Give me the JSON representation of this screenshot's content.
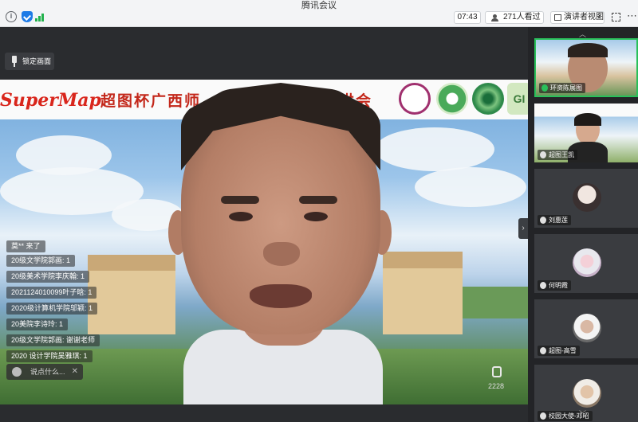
{
  "titlebar": {
    "title": "腾讯会议"
  },
  "toolbar": {
    "timer": "07:43",
    "viewers": "271人看过",
    "view_mode": "演讲者视图",
    "view_mode_caret": "▾",
    "info_icon_glyph": "i",
    "more_glyph": "⋯"
  },
  "main": {
    "lock_label": "锁定画面",
    "collapse_glyph": "›",
    "banner": {
      "brand": "SuperMap",
      "title_left": "超图杯广西师",
      "title_right": "讲会",
      "logo4_text": "GI"
    },
    "likes": "2228"
  },
  "chat": {
    "messages": [
      {
        "who": "",
        "text": "莫** 来了"
      },
      {
        "who": "",
        "text": "20级文学院郭画: 1"
      },
      {
        "who": "",
        "text": "20级美术学院李庆翰: 1"
      },
      {
        "who": "",
        "text": "2021124010099叶子晗: 1"
      },
      {
        "who": "",
        "text": "2020级计算机学院邬颖: 1"
      },
      {
        "who": "",
        "text": "20美院李诗玲: 1"
      },
      {
        "who": "",
        "text": "20级文学院郭画: 谢谢老师"
      },
      {
        "who": "",
        "text": "2020 设计学院吴雅琪: 1"
      }
    ],
    "input_placeholder": "说点什么...",
    "close_glyph": "✕"
  },
  "sidebar": {
    "scroll_up_glyph": "︿",
    "scroll_down_glyph": "﹀",
    "participants": [
      {
        "name": "环资陈展图",
        "type": "video"
      },
      {
        "name": "超图王凯",
        "type": "video"
      },
      {
        "name": "刘惠莲",
        "type": "avatar"
      },
      {
        "name": "何明霞",
        "type": "avatar"
      },
      {
        "name": "超图-高雪",
        "type": "avatar"
      },
      {
        "name": "校园大使-邓昭",
        "type": "avatar"
      }
    ]
  },
  "colors": {
    "accent_green": "#29c05a",
    "banner_red": "#c3271a",
    "chat_name": "#f2c94c"
  }
}
